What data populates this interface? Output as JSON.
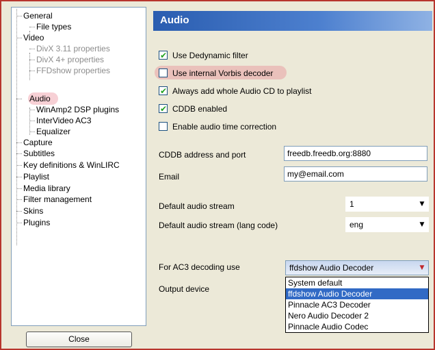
{
  "tree": {
    "items": [
      {
        "label": "General",
        "disabled": false
      },
      {
        "label": "File types",
        "disabled": false
      },
      {
        "label": "Video",
        "disabled": false
      },
      {
        "label": "DivX 3.11 properties",
        "disabled": true
      },
      {
        "label": "DivX 4+ properties",
        "disabled": true
      },
      {
        "label": "FFDshow properties",
        "disabled": true
      },
      {
        "label": "Audio",
        "disabled": false,
        "selected": true
      },
      {
        "label": "WinAmp2 DSP plugins",
        "disabled": false
      },
      {
        "label": "InterVideo AC3",
        "disabled": false
      },
      {
        "label": "Equalizer",
        "disabled": false
      },
      {
        "label": "Capture",
        "disabled": false
      },
      {
        "label": "Subtitles",
        "disabled": false
      },
      {
        "label": "Key definitions & WinLIRC",
        "disabled": false
      },
      {
        "label": "Playlist",
        "disabled": false
      },
      {
        "label": "Media library",
        "disabled": false
      },
      {
        "label": "Filter management",
        "disabled": false
      },
      {
        "label": "Skins",
        "disabled": false
      },
      {
        "label": "Plugins",
        "disabled": false
      }
    ]
  },
  "close_label": "Close",
  "panel": {
    "title": "Audio",
    "checkboxes": [
      {
        "label": "Use Dedynamic filter",
        "checked": true
      },
      {
        "label": "Use internal Vorbis decoder",
        "checked": false,
        "highlighted": true
      },
      {
        "label": "Always add whole Audio CD to playlist",
        "checked": true
      },
      {
        "label": "CDDB enabled",
        "checked": true
      },
      {
        "label": "Enable audio time correction",
        "checked": false
      }
    ],
    "cddb_label": "CDDB address and port",
    "cddb_value": "freedb.freedb.org:8880",
    "email_label": "Email",
    "email_value": "my@email.com",
    "default_stream_label": "Default audio stream",
    "default_stream_value": "1",
    "default_stream_lang_label": "Default audio stream (lang code)",
    "default_stream_lang_value": "eng",
    "ac3_label": "For AC3 decoding use",
    "ac3_value": "ffdshow Audio Decoder",
    "output_label": "Output device",
    "ac3_options": [
      {
        "label": "System default",
        "selected": false
      },
      {
        "label": "ffdshow Audio Decoder",
        "selected": true
      },
      {
        "label": "Pinnacle AC3 Decoder",
        "selected": false
      },
      {
        "label": "Nero Audio Decoder 2",
        "selected": false
      },
      {
        "label": "Pinnacle Audio Codec",
        "selected": false
      }
    ]
  },
  "colors": {
    "highlight": "#e87887",
    "header_blue": "#2a5db0",
    "selection_blue": "#316ac5",
    "frame_red": "#b8352e"
  }
}
